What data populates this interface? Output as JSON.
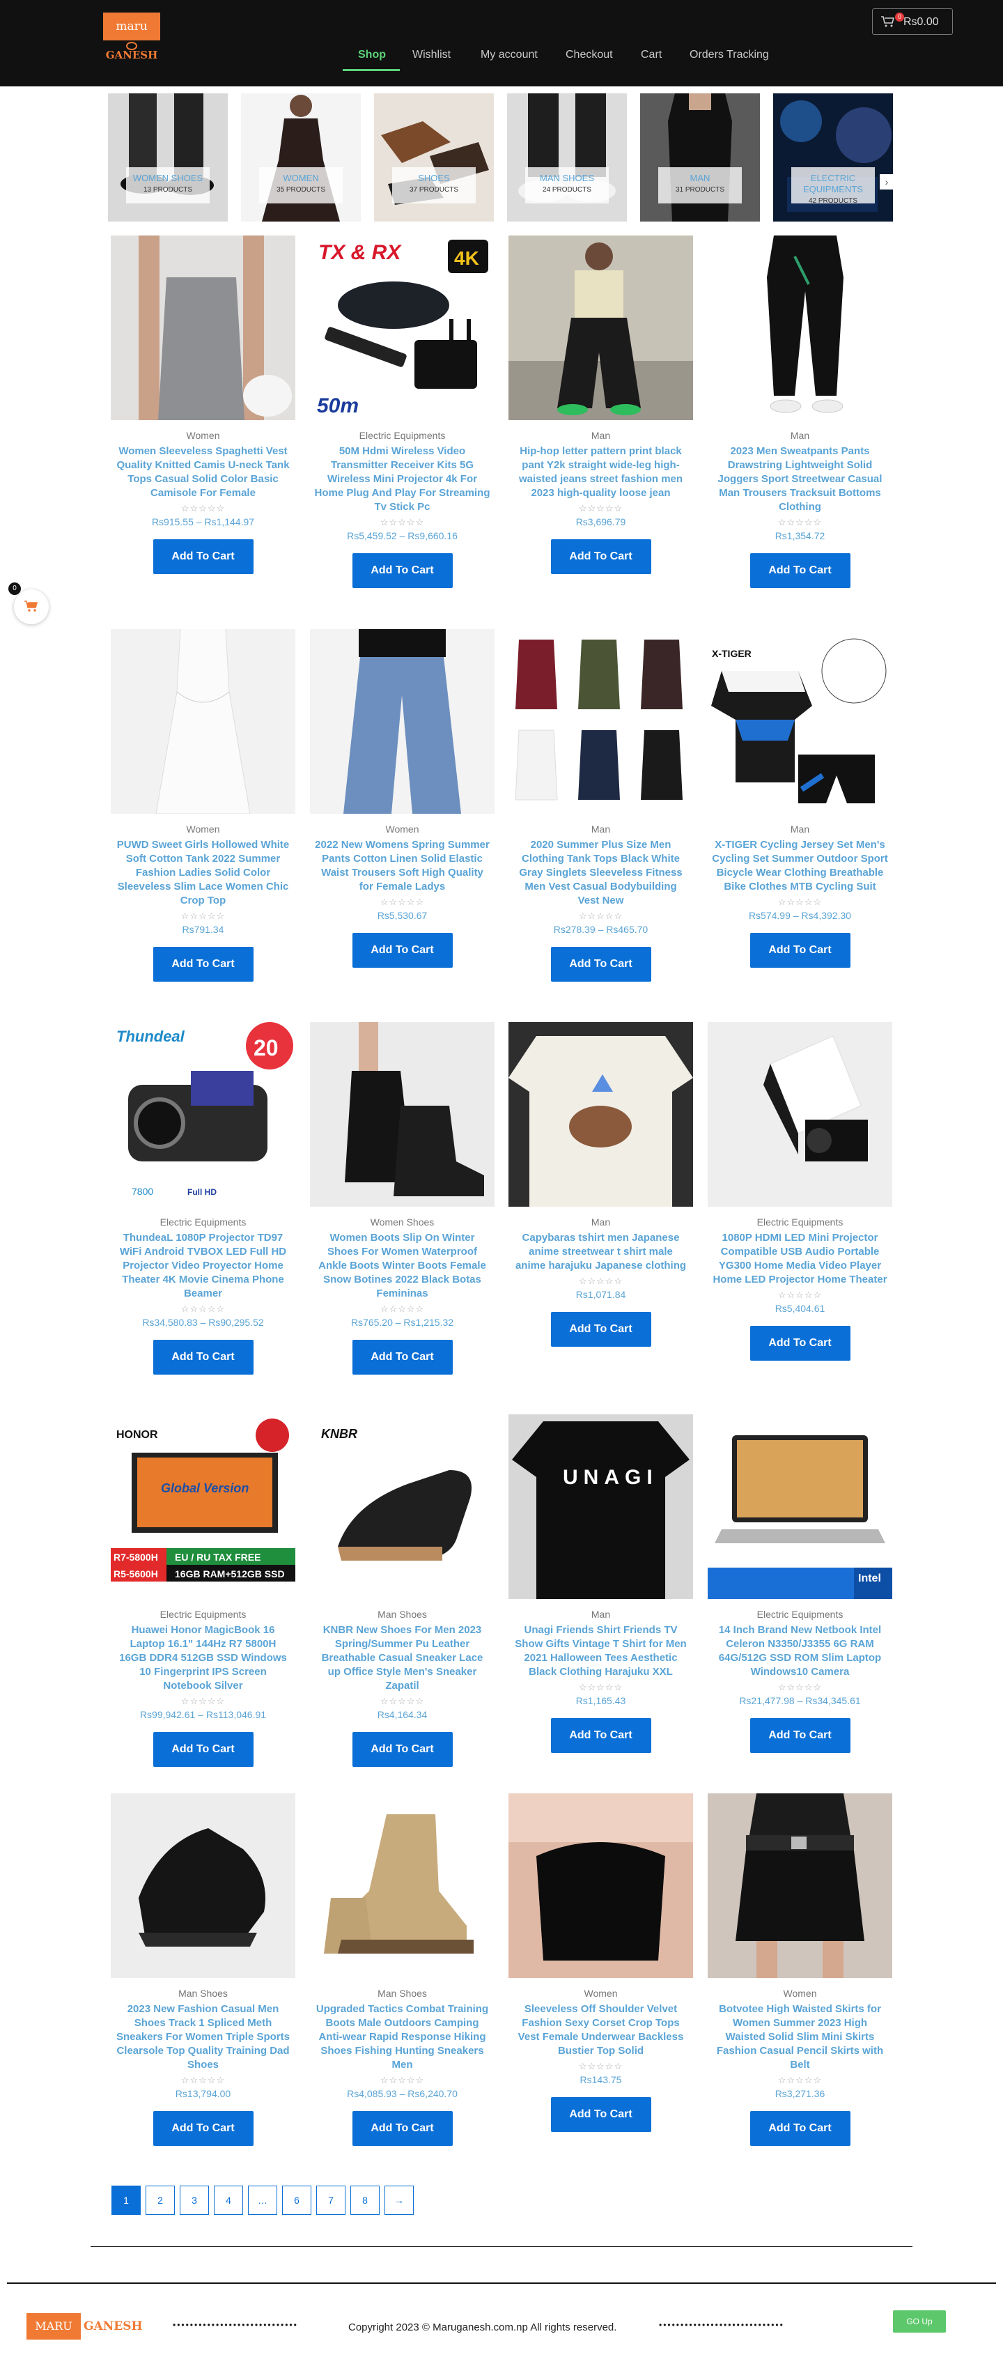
{
  "header": {
    "logo_top": "maru",
    "logo_bottom": "GANESH",
    "nav": [
      "Shop",
      "Wishlist",
      "My account",
      "Checkout",
      "Cart",
      "Orders Tracking"
    ],
    "cart_count": "0",
    "cart_total": "Rs0.00"
  },
  "categories": [
    {
      "name": "WOMEN SHOES",
      "count": "13 PRODUCTS"
    },
    {
      "name": "WOMEN",
      "count": "35 PRODUCTS"
    },
    {
      "name": "SHOES",
      "count": "37 PRODUCTS"
    },
    {
      "name": "MAN SHOES",
      "count": "24 PRODUCTS"
    },
    {
      "name": "MAN",
      "count": "31 PRODUCTS"
    },
    {
      "name": "ELECTRIC EQUIPMENTS",
      "count": "42 PRODUCTS"
    }
  ],
  "floating_cart": {
    "count": "0"
  },
  "add_to_cart_label": "Add To Cart",
  "products": [
    {
      "category": "Women",
      "title": "Women Sleeveless Spaghetti Vest Quality Knitted Camis U-neck Tank Tops Casual Solid Color Basic Camisole For Female",
      "price": "Rs915.55 – Rs1,144.97"
    },
    {
      "category": "Electric Equipments",
      "title": "50M Hdmi Wireless Video Transmitter Receiver Kits 5G Wireless Mini Projector 4k For Home Plug And Play For Streaming Tv Stick Pc",
      "price": "Rs5,459.52 – Rs9,660.16"
    },
    {
      "category": "Man",
      "title": "Hip-hop letter pattern print black pant Y2k straight wide-leg high-waisted jeans street fashion men 2023 high-quality loose jean",
      "price": "Rs3,696.79"
    },
    {
      "category": "Man",
      "title": "2023 Men Sweatpants Pants Drawstring Lightweight Solid Joggers Sport Streetwear Casual Man Trousers Tracksuit Bottoms Clothing",
      "price": "Rs1,354.72"
    },
    {
      "category": "Women",
      "title": "PUWD Sweet Girls Hollowed White Soft Cotton Tank 2022 Summer Fashion Ladies Solid Color Sleeveless Slim Lace Women Chic Crop Top",
      "price": "Rs791.34"
    },
    {
      "category": "Women",
      "title": "2022 New Womens Spring Summer Pants Cotton Linen Solid Elastic Waist Trousers Soft High Quality for Female Ladys",
      "price": "Rs5,530.67"
    },
    {
      "category": "Man",
      "title": "2020 Summer Plus Size Men Clothing Tank Tops Black White Gray Singlets Sleeveless Fitness Men Vest Casual Bodybuilding Vest New",
      "price": "Rs278.39 – Rs465.70"
    },
    {
      "category": "Man",
      "title": "X-TIGER Cycling Jersey Set Men's Cycling Set Summer Outdoor Sport Bicycle Wear Clothing Breathable Bike Clothes MTB Cycling Suit",
      "price": "Rs574.99 – Rs4,392.30"
    },
    {
      "category": "Electric Equipments",
      "title": "ThundeaL 1080P Projector TD97 WiFi Android TVBOX LED Full HD Projector Video Proyector Home Theater 4K Movie Cinema Phone Beamer",
      "price": "Rs34,580.83 – Rs90,295.52"
    },
    {
      "category": "Women Shoes",
      "title": "Women Boots Slip On Winter Shoes For Women Waterproof Ankle Boots Winter Boots Female Snow Botines 2022 Black Botas Femininas",
      "price": "Rs765.20 – Rs1,215.32"
    },
    {
      "category": "Man",
      "title": "Capybaras tshirt men Japanese anime streetwear t shirt male anime harajuku Japanese clothing",
      "price": "Rs1,071.84"
    },
    {
      "category": "Electric Equipments",
      "title": "1080P HDMI LED Mini Projector Compatible USB Audio Portable YG300 Home Media Video Player Home LED Projector Home Theater",
      "price": "Rs5,404.61"
    },
    {
      "category": "Electric Equipments",
      "title": "Huawei Honor MagicBook 16 Laptop 16.1\" 144Hz R7 5800H 16GB DDR4 512GB SSD Windows 10 Fingerprint IPS Screen Notebook Silver",
      "price": "Rs99,942.61 – Rs113,046.91"
    },
    {
      "category": "Man Shoes",
      "title": "KNBR New Shoes For Men 2023 Spring/Summer Pu Leather Breathable Casual Sneaker Lace up Office Style Men's Sneaker Zapatil",
      "price": "Rs4,164.34"
    },
    {
      "category": "Man",
      "title": "Unagi Friends Shirt Friends TV Show Gifts Vintage T Shirt for Men 2021 Halloween Tees Aesthetic Black Clothing Harajuku XXL",
      "price": "Rs1,165.43"
    },
    {
      "category": "Electric Equipments",
      "title": "14 Inch Brand New Netbook Intel Celeron N3350/J3355 6G RAM 64G/512G SSD ROM Slim Laptop Windows10 Camera",
      "price": "Rs21,477.98 – Rs34,345.61"
    },
    {
      "category": "Man Shoes",
      "title": "2023 New Fashion Casual Men Shoes Track 1 Spliced Meth Sneakers For Women Triple Sports Clearsole Top Quality Training Dad Shoes",
      "price": "Rs13,794.00"
    },
    {
      "category": "Man Shoes",
      "title": "Upgraded Tactics Combat Training Boots Male Outdoors Camping Anti-wear Rapid Response Hiking Shoes Fishing Hunting Sneakers Men",
      "price": "Rs4,085.93 – Rs6,240.70"
    },
    {
      "category": "Women",
      "title": "Sleeveless Off Shoulder Velvet Fashion Sexy Corset Crop Tops Vest Female Underwear Backless Bustier Top Solid",
      "price": "Rs143.75"
    },
    {
      "category": "Women",
      "title": "Botvotee High Waisted Skirts for Women Summer 2023 High Waisted Solid Slim Mini Skirts Fashion Casual Pencil Skirts with Belt",
      "price": "Rs3,271.36"
    }
  ],
  "pagination": [
    "1",
    "2",
    "3",
    "4",
    "…",
    "6",
    "7",
    "8",
    "→"
  ],
  "footer": {
    "logo_a": "MARU",
    "logo_b": "GANESH",
    "dots": "•••••••••••••••••••••••••••••",
    "copyright": "Copyright 2023 © Maruganesh.com.np All rights reserved.",
    "go_up": "GO Up"
  },
  "image_text": {
    "txrx": "TX & RX",
    "fourk": "4K",
    "fiftym": "50m",
    "thundeal": "Thundeal",
    "twenty": "20",
    "honor": "HONOR",
    "knbr": "KNBR",
    "unagi": "UNAGI",
    "intel": "Intel",
    "xtiger": "X-TIGER",
    "global": "Global Version",
    "r7a": "R7-5800H",
    "r7b": "R5-5600H",
    "eu": "EU / RU TAX FREE",
    "ram": "16GB RAM+512GB SSD",
    "fullhd": "Full HD",
    "lumens": "7800"
  },
  "colors": {
    "accent": "#0a6fd6",
    "link": "#5aa4d6",
    "nav_active": "#5dd27a",
    "brand": "#f07a34",
    "header_bg": "#111111"
  }
}
